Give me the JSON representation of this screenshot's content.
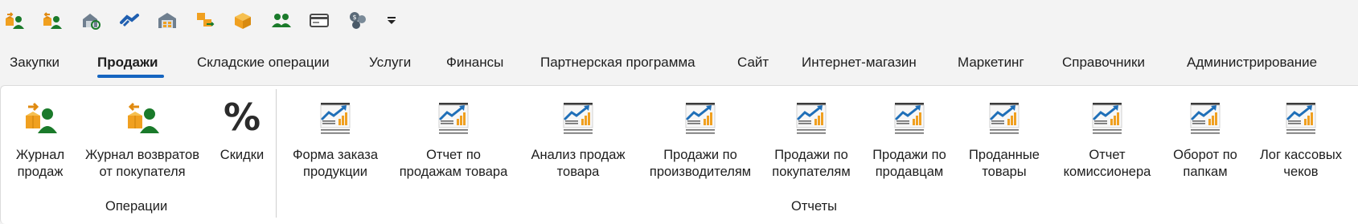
{
  "quick_access": [
    {
      "icon": "box-user-icon"
    },
    {
      "icon": "box-user-return-icon"
    },
    {
      "icon": "warehouse-cycle-icon"
    },
    {
      "icon": "handshake-icon"
    },
    {
      "icon": "warehouse-icon"
    },
    {
      "icon": "box-transfer-icon"
    },
    {
      "icon": "boxes-icon"
    },
    {
      "icon": "users-group-icon"
    },
    {
      "icon": "card-icon"
    },
    {
      "icon": "currency-icon"
    },
    {
      "icon": "dropdown-arrow-icon"
    }
  ],
  "tabs": [
    {
      "label": "Закупки",
      "active": false
    },
    {
      "label": "Продажи",
      "active": true
    },
    {
      "label": "Складские операции",
      "active": false
    },
    {
      "label": "Услуги",
      "active": false
    },
    {
      "label": "Финансы",
      "active": false
    },
    {
      "label": "Партнерская программа",
      "active": false
    },
    {
      "label": "Сайт",
      "active": false
    },
    {
      "label": "Интернет-магазин",
      "active": false
    },
    {
      "label": "Маркетинг",
      "active": false
    },
    {
      "label": "Справочники",
      "active": false
    },
    {
      "label": "Администрирование",
      "active": false
    }
  ],
  "groups": {
    "operations": {
      "label": "Операции",
      "buttons": [
        {
          "label": "Журнал\nпродаж",
          "icon": "sales-journal-icon"
        },
        {
          "label": "Журнал возвратов\nот покупателя",
          "icon": "returns-journal-icon"
        },
        {
          "label": "Скидки",
          "icon": "percent-icon",
          "glyph": "%"
        }
      ]
    },
    "reports": {
      "label": "Отчеты",
      "buttons": [
        {
          "label": "Форма заказа\nпродукции",
          "icon": "report-chart-icon"
        },
        {
          "label": "Отчет по\nпродажам товара",
          "icon": "report-chart-icon"
        },
        {
          "label": "Анализ продаж\nтовара",
          "icon": "report-chart-icon"
        },
        {
          "label": "Продажи по\nпроизводителям",
          "icon": "report-chart-icon"
        },
        {
          "label": "Продажи по\nпокупателям",
          "icon": "report-chart-icon"
        },
        {
          "label": "Продажи по\nпродавцам",
          "icon": "report-chart-icon"
        },
        {
          "label": "Проданные\nтовары",
          "icon": "report-chart-icon"
        },
        {
          "label": "Отчет\nкомиссионера",
          "icon": "report-chart-icon"
        },
        {
          "label": "Оборот по\nпапкам",
          "icon": "report-chart-icon"
        },
        {
          "label": "Лог кассовых\nчеков",
          "icon": "report-chart-icon"
        }
      ]
    }
  },
  "colors": {
    "accent": "#1565c0",
    "box": "#f0a020",
    "user": "#1a7a2a",
    "chart_line": "#1f6fb8",
    "chart_bars": "#f0a020"
  }
}
